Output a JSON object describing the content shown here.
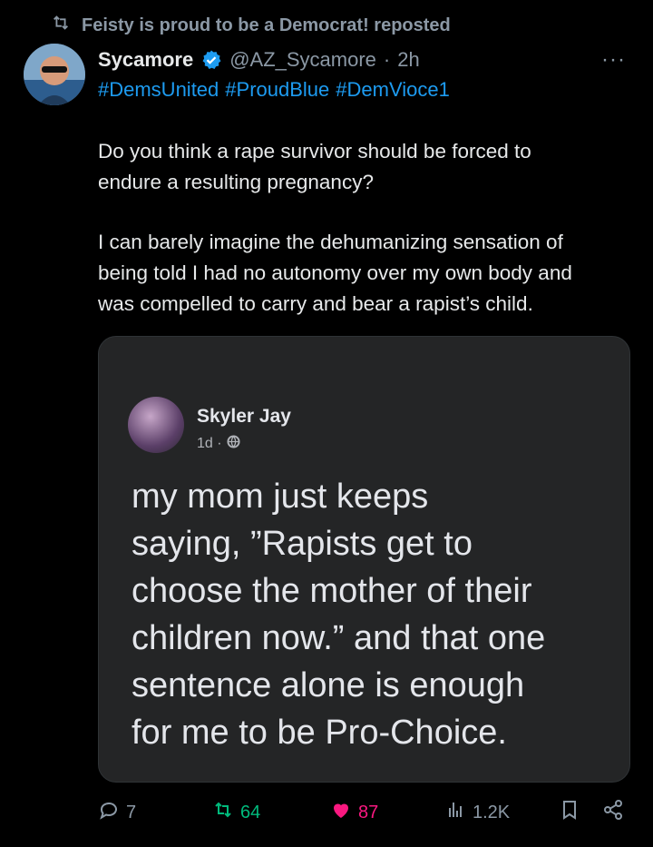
{
  "repost": {
    "label": "Feisty is proud to be a Democrat! reposted",
    "icon": "repost-icon"
  },
  "tweet": {
    "name": "Sycamore",
    "handle": "@AZ_Sycamore",
    "dot": "·",
    "time": "2h",
    "more": "···",
    "hashtags": [
      "#DemsUnited",
      "#ProudBlue",
      "#DemVioce1"
    ],
    "paragraph1": "Do you think a rape survivor should be forced to\nendure a resulting pregnancy?",
    "paragraph2": "I can barely imagine the dehumanizing sensation of\nbeing told I had no autonomy over my own body and\nwas compelled to carry and bear a rapist’s child."
  },
  "media": {
    "author": "Skyler Jay",
    "meta": "1d ·",
    "text": "my mom just keeps\nsaying, ”Rapists get to\nchoose the mother of their\nchildren now.” and that one\nsentence alone is enough\nfor me to be Pro-Choice."
  },
  "actions": {
    "replies": "7",
    "reposts": "64",
    "likes": "87",
    "views": "1.2K"
  },
  "colors": {
    "accent": "#1d9bf0",
    "repost_green": "#00ba7c",
    "like_pink": "#f91880",
    "muted": "#8b98a5",
    "background": "#000000"
  }
}
